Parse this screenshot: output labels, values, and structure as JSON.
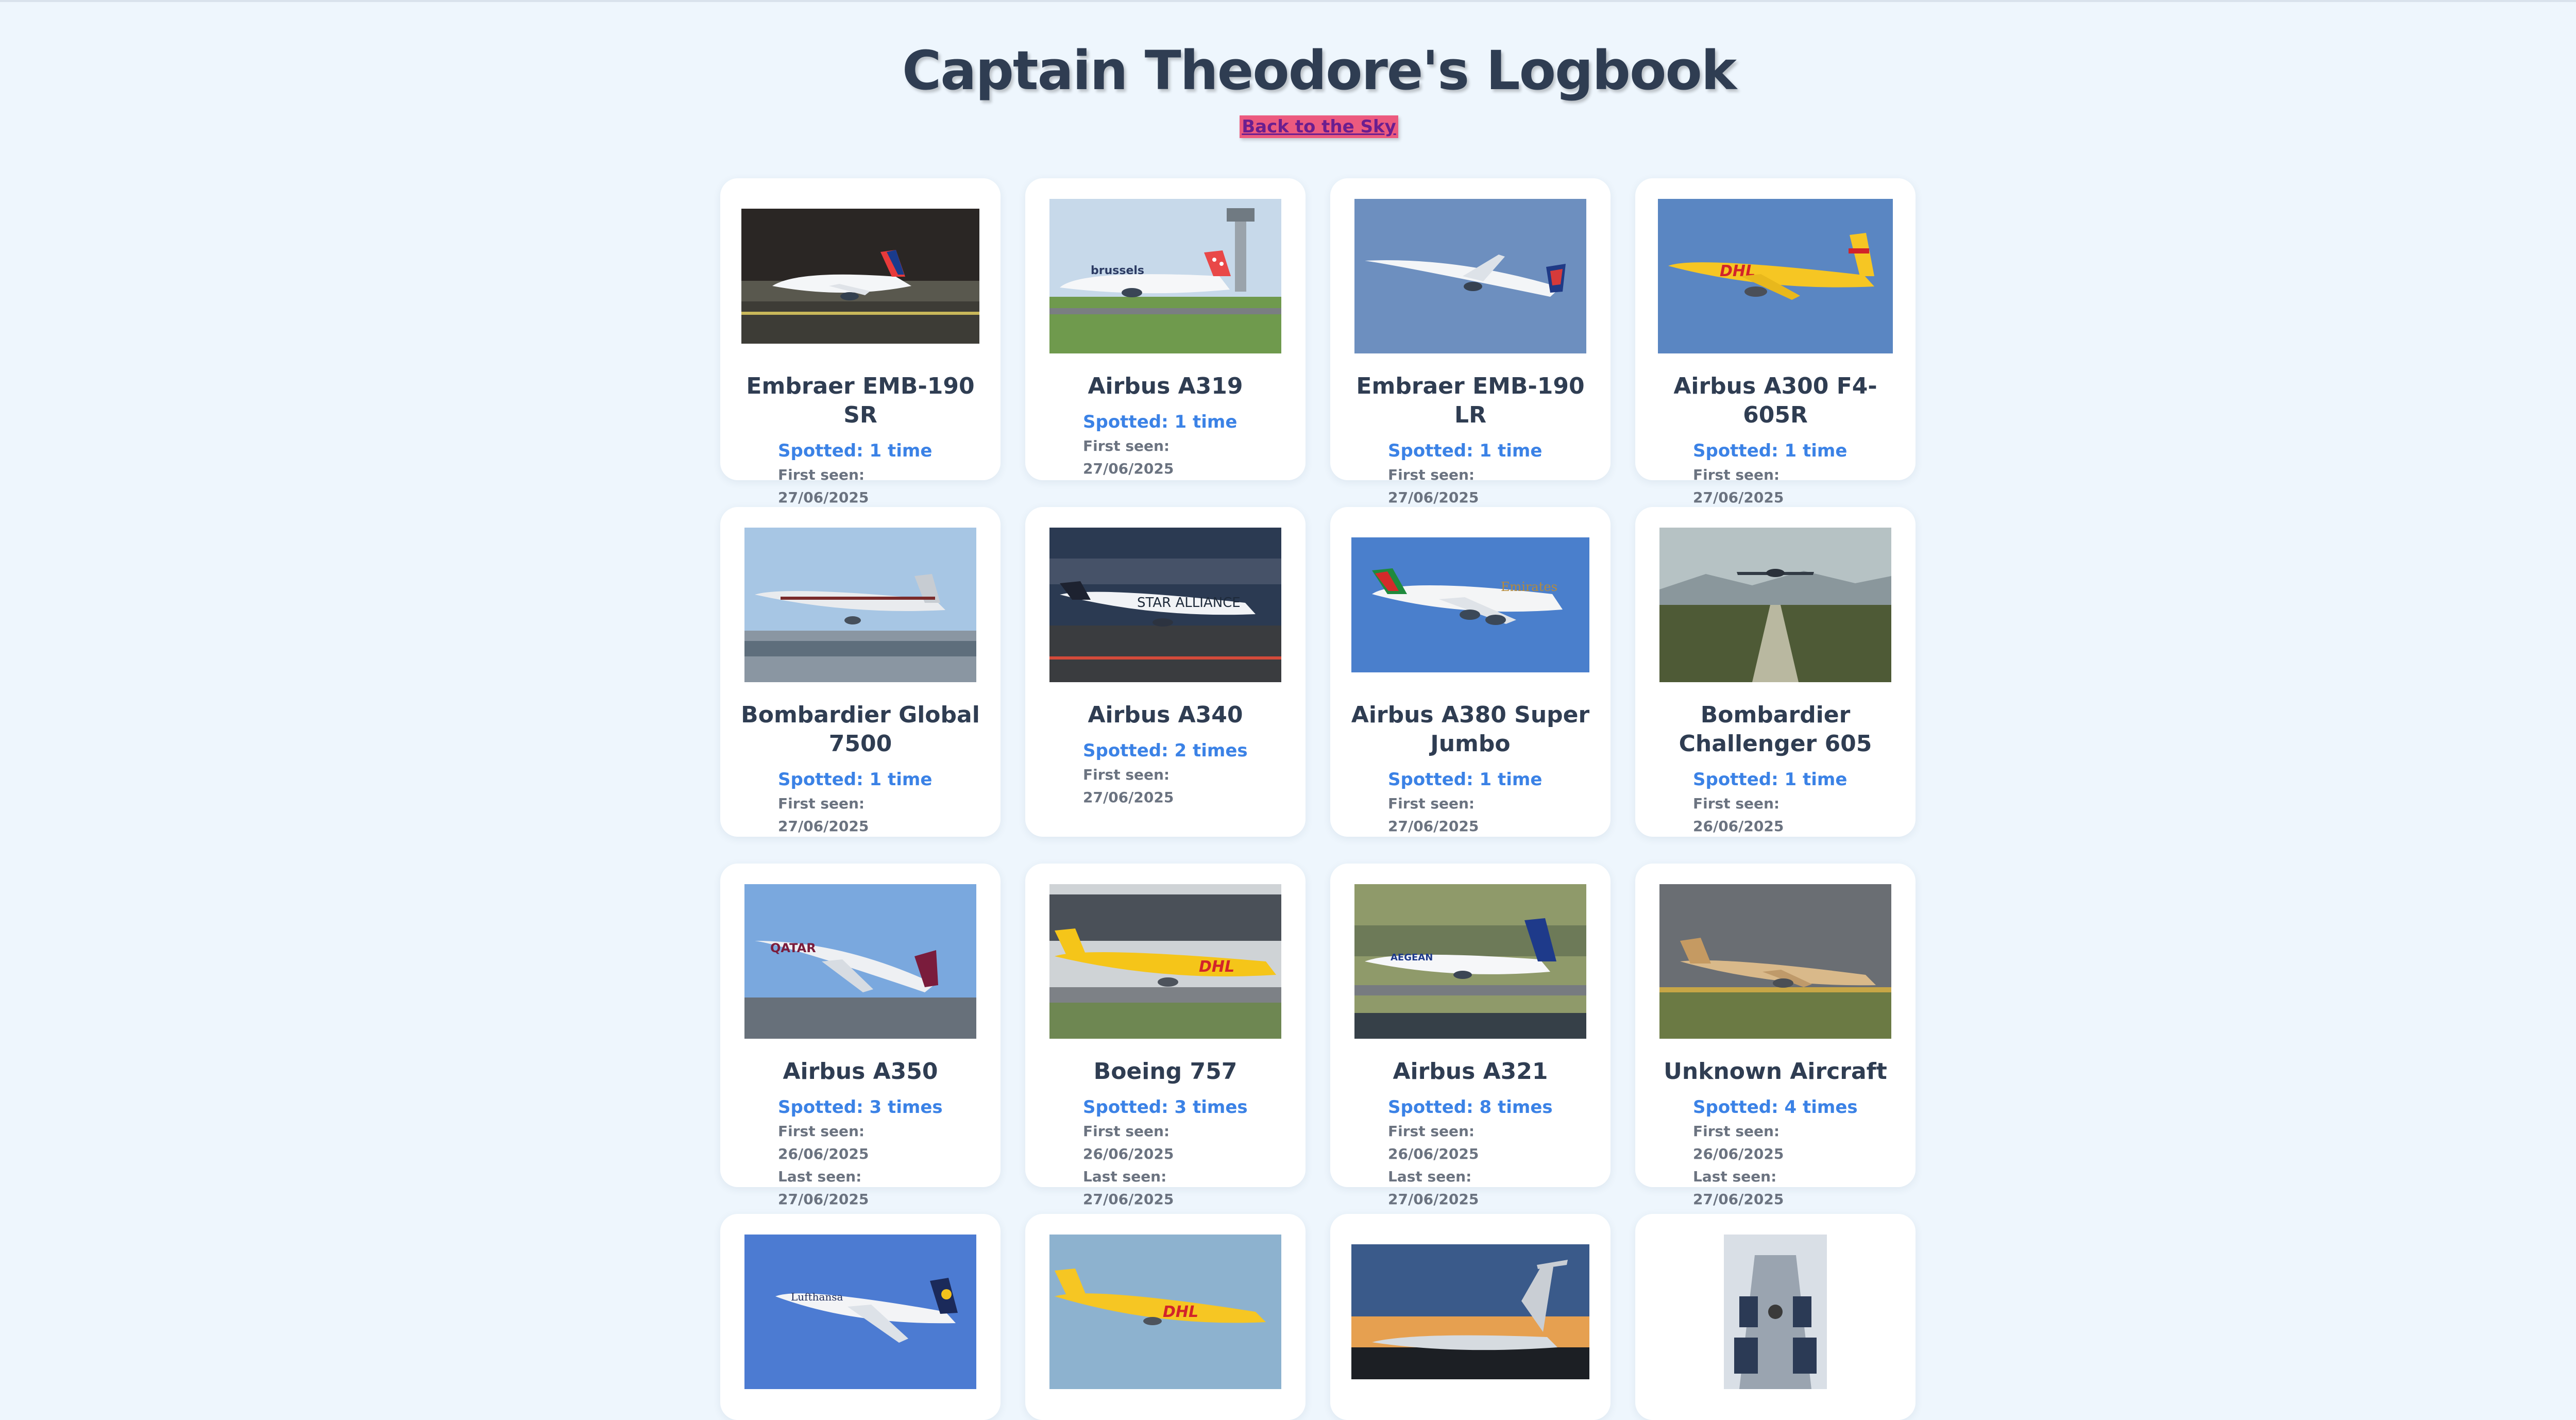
{
  "page": {
    "title": "Captain Theodore's Logbook",
    "back_link": "Back to the Sky"
  },
  "cards": [
    {
      "name": "Embraer EMB-190 SR",
      "spotted": "Spotted: 1 time",
      "first_seen": "First seen: 27/06/2025",
      "photo": "embraer-ba-taxi-photo"
    },
    {
      "name": "Airbus A319",
      "spotted": "Spotted: 1 time",
      "first_seen": "First seen: 27/06/2025",
      "photo": "brussels-airlines-runway-photo"
    },
    {
      "name": "Embraer EMB-190 LR",
      "spotted": "Spotted: 1 time",
      "first_seen": "First seen: 27/06/2025",
      "photo": "embraer-ba-climb-photo"
    },
    {
      "name": "Airbus A300 F4-605R",
      "spotted": "Spotted: 1 time",
      "first_seen": "First seen: 27/06/2025",
      "photo": "dhl-a300-photo"
    },
    {
      "name": "Bombardier Global 7500",
      "spotted": "Spotted: 1 time",
      "first_seen": "First seen: 27/06/2025",
      "photo": "global-7500-photo"
    },
    {
      "name": "Airbus A340",
      "spotted": "Spotted: 2 times",
      "first_seen": "First seen: 27/06/2025",
      "photo": "star-alliance-a340-photo"
    },
    {
      "name": "Airbus A380 Super Jumbo",
      "spotted": "Spotted: 1 time",
      "first_seen": "First seen: 27/06/2025",
      "photo": "emirates-a380-photo"
    },
    {
      "name": "Bombardier Challenger 605",
      "spotted": "Spotted: 1 time",
      "first_seen": "First seen: 26/06/2025",
      "photo": "challenger-approach-photo"
    },
    {
      "name": "Airbus A350",
      "spotted": "Spotted: 3 times",
      "first_seen": "First seen: 26/06/2025",
      "last_seen": "Last seen: 27/06/2025",
      "photo": "qatar-a350-photo"
    },
    {
      "name": "Boeing 757",
      "spotted": "Spotted: 3 times",
      "first_seen": "First seen: 26/06/2025",
      "last_seen": "Last seen: 27/06/2025",
      "photo": "dhl-757-photo"
    },
    {
      "name": "Airbus A321",
      "spotted": "Spotted: 8 times",
      "first_seen": "First seen: 26/06/2025",
      "last_seen": "Last seen: 27/06/2025",
      "photo": "aegean-a321-photo"
    },
    {
      "name": "Unknown Aircraft",
      "spotted": "Spotted: 4 times",
      "first_seen": "First seen: 26/06/2025",
      "last_seen": "Last seen: 27/06/2025",
      "photo": "etihad-landing-photo"
    },
    {
      "photo": "lufthansa-747-photo"
    },
    {
      "photo": "dhl-737-photo"
    },
    {
      "photo": "bizjet-sunset-photo"
    },
    {
      "photo": "cabin-interior-photo"
    }
  ],
  "colors": {
    "background": "#eef6fd",
    "title": "#2f3d52",
    "spotted": "#3b82e6",
    "seen": "#6b7380",
    "link_bg": "#ec5a7f",
    "link_text": "#6b1e8f"
  }
}
